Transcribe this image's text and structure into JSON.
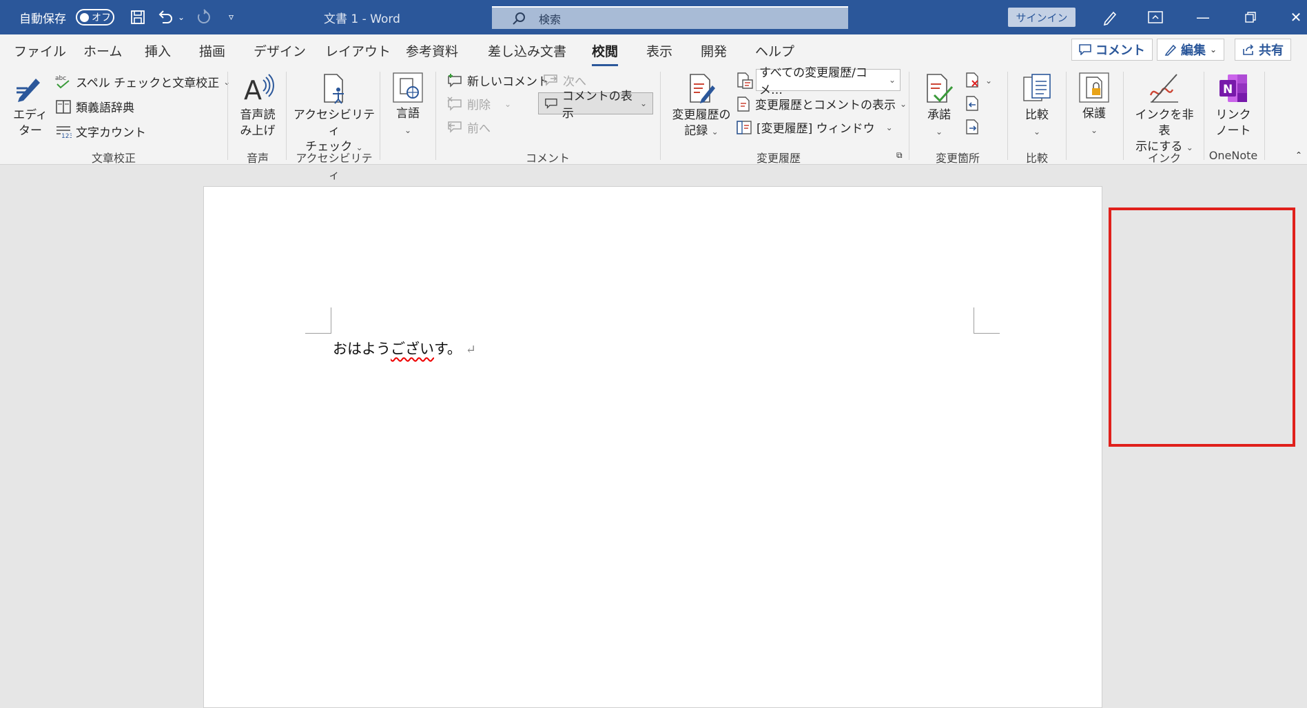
{
  "titlebar": {
    "autosave_label": "自動保存",
    "autosave_toggle": "オフ",
    "doc_title": "文書 1  -  Word",
    "search_placeholder": "検索",
    "signin_label": "サインイン"
  },
  "tabs": [
    {
      "label": "ファイル"
    },
    {
      "label": "ホーム"
    },
    {
      "label": "挿入"
    },
    {
      "label": "描画"
    },
    {
      "label": "デザイン"
    },
    {
      "label": "レイアウト"
    },
    {
      "label": "参考資料"
    },
    {
      "label": "差し込み文書"
    },
    {
      "label": "校閲",
      "active": true
    },
    {
      "label": "表示"
    },
    {
      "label": "開発"
    },
    {
      "label": "ヘルプ"
    }
  ],
  "top_actions": {
    "comment_label": "コメント",
    "edit_label": "編集",
    "share_label": "共有"
  },
  "ribbon": {
    "proofing": {
      "editor_label": "エディ\nター",
      "spell_label": "スペル チェックと文章校正",
      "thesaurus_label": "類義語辞典",
      "wordcount_label": "文字カウント",
      "group_label": "文章校正"
    },
    "speech": {
      "read_aloud_label": "音声読\nみ上げ",
      "group_label": "音声"
    },
    "accessibility": {
      "check_label": "アクセシビリティ\nチェック",
      "group_label": "アクセシビリティ"
    },
    "language": {
      "label": "言語"
    },
    "comments": {
      "new_label": "新しいコメント",
      "delete_label": "削除",
      "prev_label": "前へ",
      "next_label": "次へ",
      "show_label": "コメントの表示",
      "group_label": "コメント"
    },
    "tracking": {
      "track_label": "変更履歴の\n記録",
      "markup_dropdown": "すべての変更履歴/コメ…",
      "show_markup_label": "変更履歴とコメントの表示",
      "pane_label": "[変更履歴] ウィンドウ",
      "group_label": "変更履歴"
    },
    "changes": {
      "accept_label": "承諾",
      "group_label": "変更箇所"
    },
    "compare": {
      "label": "比較",
      "group_label": "比較"
    },
    "protect": {
      "label": "保護"
    },
    "ink": {
      "label": "インクを非表\n示にする",
      "group_label": "インク"
    },
    "onenote": {
      "label": "リンク\nノート",
      "group_label": "OneNote"
    }
  },
  "document": {
    "text_before": "おはよう",
    "text_squiggle": "ござい",
    "text_after": "す。",
    "para_mark": "↵"
  },
  "colors": {
    "titlebar": "#2b579a",
    "highlight_box": "#e0201b"
  }
}
